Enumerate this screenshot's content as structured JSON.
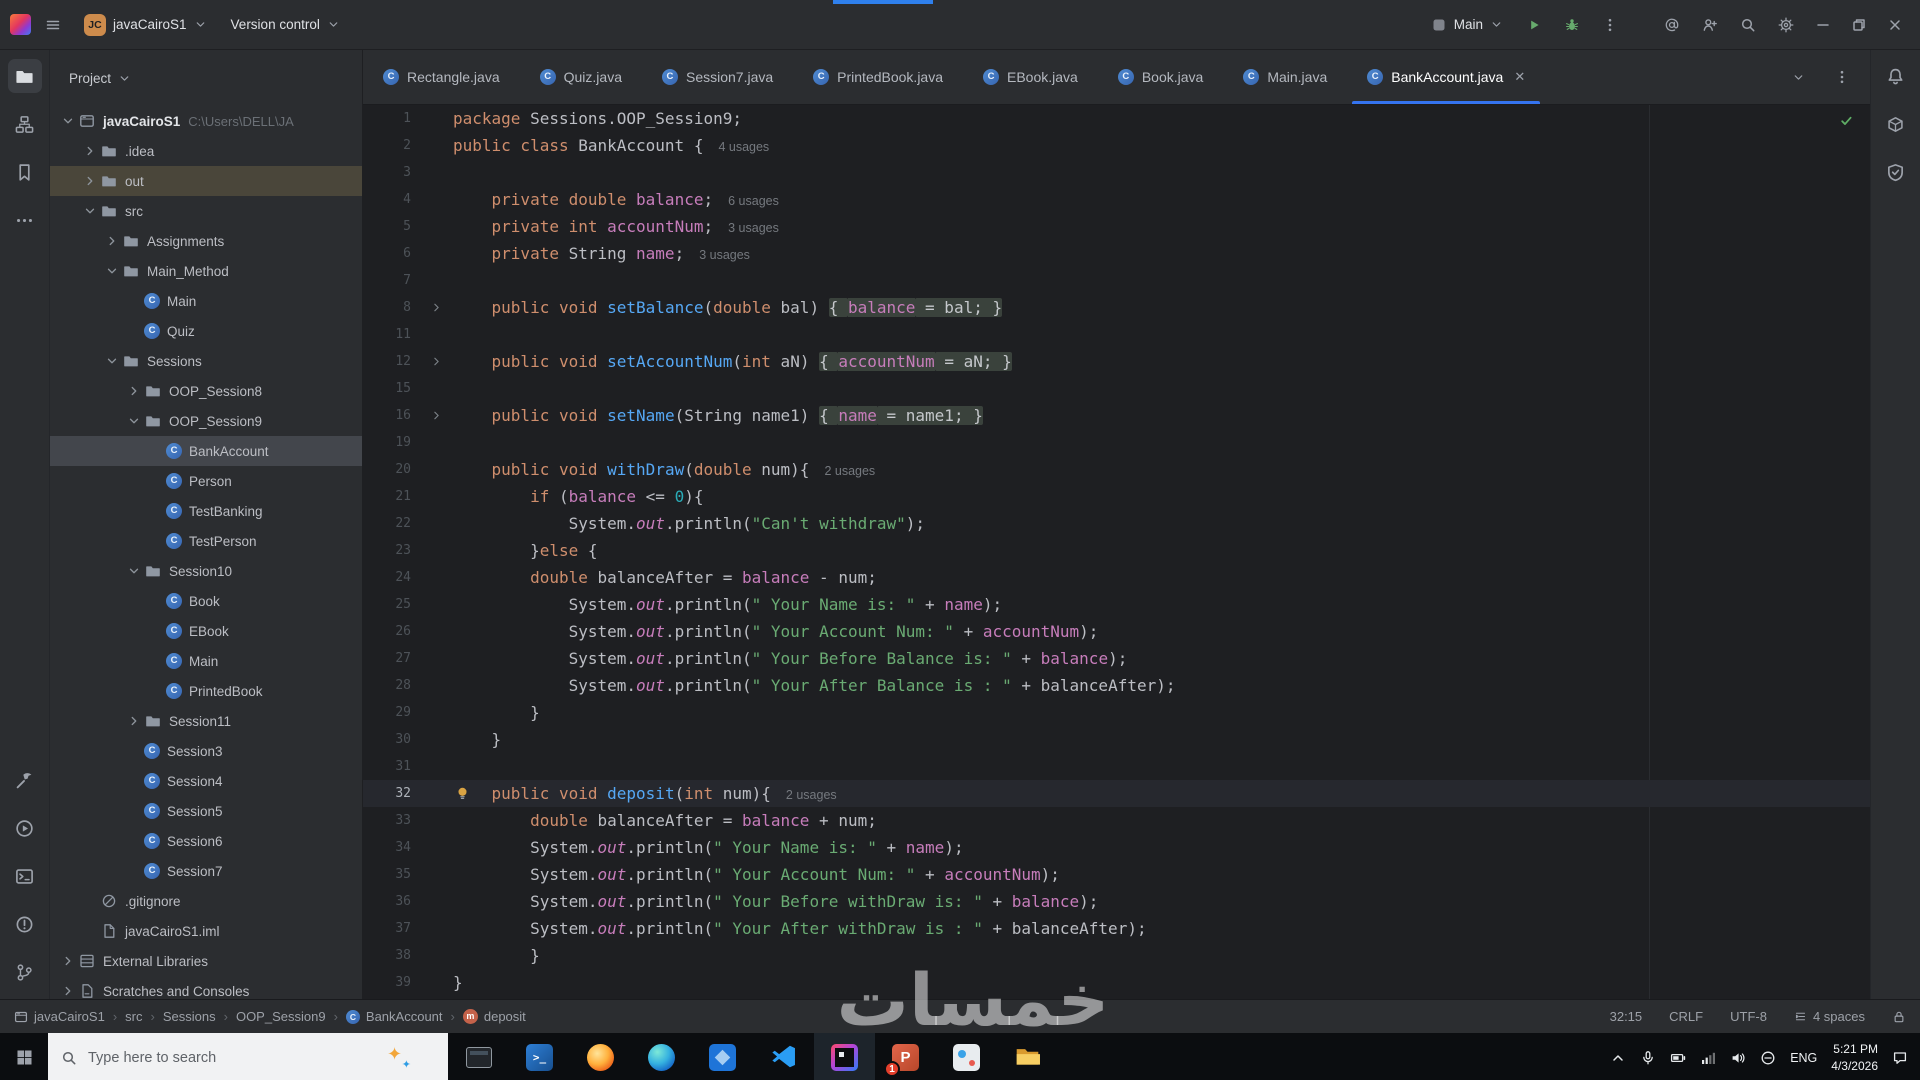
{
  "title_bar": {
    "avatar": "JC",
    "project": "javaCairoS1",
    "vcs": "Version control",
    "run_config": "Main"
  },
  "tab_bar": {
    "tabs": [
      {
        "label": "Rectangle.java"
      },
      {
        "label": "Quiz.java"
      },
      {
        "label": "Session7.java"
      },
      {
        "label": "PrintedBook.java"
      },
      {
        "label": "EBook.java"
      },
      {
        "label": "Book.java"
      },
      {
        "label": "Main.java"
      },
      {
        "label": "BankAccount.java",
        "active": true
      }
    ]
  },
  "left_strip": {
    "top": [
      "project",
      "structure",
      "bookmarks",
      "more-tools"
    ],
    "bottom": [
      "build",
      "services",
      "terminal",
      "problems",
      "version-control"
    ],
    "active": "project"
  },
  "right_strip": [
    "notifications",
    "build-tools",
    "dependency-checker"
  ],
  "project_panel": {
    "header": "Project",
    "tree": [
      {
        "depth": 0,
        "label": "javaCairoS1",
        "icon": "project",
        "chevron": "open",
        "bold": true,
        "suffix": "C:\\Users\\DELL\\JA"
      },
      {
        "depth": 1,
        "label": ".idea",
        "icon": "folder",
        "chevron": "closed"
      },
      {
        "depth": 1,
        "label": "out",
        "icon": "folder",
        "chevron": "closed",
        "highlight": true
      },
      {
        "depth": 1,
        "label": "src",
        "icon": "folder",
        "chevron": "open"
      },
      {
        "depth": 2,
        "label": "Assignments",
        "icon": "folder",
        "chevron": "closed"
      },
      {
        "depth": 2,
        "label": "Main_Method",
        "icon": "folder",
        "chevron": "open"
      },
      {
        "depth": 3,
        "label": "Main",
        "icon": "class"
      },
      {
        "depth": 3,
        "label": "Quiz",
        "icon": "class"
      },
      {
        "depth": 2,
        "label": "Sessions",
        "icon": "folder",
        "chevron": "open"
      },
      {
        "depth": 3,
        "label": "OOP_Session8",
        "icon": "folder",
        "chevron": "closed"
      },
      {
        "depth": 3,
        "label": "OOP_Session9",
        "icon": "folder",
        "chevron": "open"
      },
      {
        "depth": 4,
        "label": "BankAccount",
        "icon": "class",
        "selected": true
      },
      {
        "depth": 4,
        "label": "Person",
        "icon": "class"
      },
      {
        "depth": 4,
        "label": "TestBanking",
        "icon": "class"
      },
      {
        "depth": 4,
        "label": "TestPerson",
        "icon": "class"
      },
      {
        "depth": 3,
        "label": "Session10",
        "icon": "folder",
        "chevron": "open"
      },
      {
        "depth": 4,
        "label": "Book",
        "icon": "class"
      },
      {
        "depth": 4,
        "label": "EBook",
        "icon": "class"
      },
      {
        "depth": 4,
        "label": "Main",
        "icon": "class"
      },
      {
        "depth": 4,
        "label": "PrintedBook",
        "icon": "class"
      },
      {
        "depth": 3,
        "label": "Session11",
        "icon": "folder",
        "chevron": "closed"
      },
      {
        "depth": 3,
        "label": "Session3",
        "icon": "class"
      },
      {
        "depth": 3,
        "label": "Session4",
        "icon": "class"
      },
      {
        "depth": 3,
        "label": "Session5",
        "icon": "class"
      },
      {
        "depth": 3,
        "label": "Session6",
        "icon": "class"
      },
      {
        "depth": 3,
        "label": "Session7",
        "icon": "class"
      },
      {
        "depth": 1,
        "label": ".gitignore",
        "icon": "ignore"
      },
      {
        "depth": 1,
        "label": "javaCairoS1.iml",
        "icon": "file"
      },
      {
        "depth": 0,
        "label": "External Libraries",
        "icon": "library",
        "chevron": "closed"
      },
      {
        "depth": 0,
        "label": "Scratches and Consoles",
        "icon": "scratch",
        "chevron": "closed"
      }
    ]
  },
  "editor": {
    "lines": [
      {
        "num": "1",
        "tokens": [
          [
            "kw",
            "package"
          ],
          [
            "pl",
            " Sessions.OOP_Session9;"
          ]
        ]
      },
      {
        "num": "2",
        "tokens": [
          [
            "kw",
            "public class"
          ],
          [
            "pl",
            " BankAccount {"
          ]
        ],
        "hint": "4 usages"
      },
      {
        "num": "3",
        "tokens": []
      },
      {
        "num": "4",
        "tokens": [
          [
            "pl",
            "    "
          ],
          [
            "kw",
            "private double"
          ],
          [
            "pl",
            " "
          ],
          [
            "fld",
            "balance"
          ],
          [
            "pl",
            ";"
          ]
        ],
        "hint": "6 usages"
      },
      {
        "num": "5",
        "tokens": [
          [
            "pl",
            "    "
          ],
          [
            "kw",
            "private int"
          ],
          [
            "pl",
            " "
          ],
          [
            "fld",
            "accountNum"
          ],
          [
            "pl",
            ";"
          ]
        ],
        "hint": "3 usages"
      },
      {
        "num": "6",
        "tokens": [
          [
            "pl",
            "    "
          ],
          [
            "kw",
            "private"
          ],
          [
            "pl",
            " String "
          ],
          [
            "fld",
            "name"
          ],
          [
            "pl",
            ";"
          ]
        ],
        "hint": "3 usages"
      },
      {
        "num": "7",
        "tokens": []
      },
      {
        "num": "8",
        "fold": true,
        "tokens": [
          [
            "pl",
            "    "
          ],
          [
            "kw",
            "public void"
          ],
          [
            "pl",
            " "
          ],
          [
            "mtd",
            "setBalance"
          ],
          [
            "pl",
            "("
          ],
          [
            "kw",
            "double"
          ],
          [
            "pl",
            " bal) "
          ],
          [
            "fold",
            "{ "
          ],
          [
            "ffld",
            "balance"
          ],
          [
            "fold",
            " = bal; }"
          ]
        ]
      },
      {
        "num": "11",
        "tokens": []
      },
      {
        "num": "12",
        "fold": true,
        "tokens": [
          [
            "pl",
            "    "
          ],
          [
            "kw",
            "public void"
          ],
          [
            "pl",
            " "
          ],
          [
            "mtd",
            "setAccountNum"
          ],
          [
            "pl",
            "("
          ],
          [
            "kw",
            "int"
          ],
          [
            "pl",
            " aN) "
          ],
          [
            "fold",
            "{ "
          ],
          [
            "ffld",
            "accountNum"
          ],
          [
            "fold",
            " = aN; }"
          ]
        ]
      },
      {
        "num": "15",
        "tokens": []
      },
      {
        "num": "16",
        "fold": true,
        "tokens": [
          [
            "pl",
            "    "
          ],
          [
            "kw",
            "public void"
          ],
          [
            "pl",
            " "
          ],
          [
            "mtd",
            "setName"
          ],
          [
            "pl",
            "(String name1) "
          ],
          [
            "fold",
            "{ "
          ],
          [
            "ffld",
            "name"
          ],
          [
            "fold",
            " = name1; }"
          ]
        ]
      },
      {
        "num": "19",
        "tokens": []
      },
      {
        "num": "20",
        "tokens": [
          [
            "pl",
            "    "
          ],
          [
            "kw",
            "public void"
          ],
          [
            "pl",
            " "
          ],
          [
            "mtd",
            "withDraw"
          ],
          [
            "pl",
            "("
          ],
          [
            "kw",
            "double"
          ],
          [
            "pl",
            " num){"
          ]
        ],
        "hint": "2 usages"
      },
      {
        "num": "21",
        "tokens": [
          [
            "pl",
            "        "
          ],
          [
            "kw",
            "if"
          ],
          [
            "pl",
            " ("
          ],
          [
            "fld",
            "balance"
          ],
          [
            "pl",
            " <= "
          ],
          [
            "num",
            "0"
          ],
          [
            "pl",
            "){"
          ]
        ]
      },
      {
        "num": "22",
        "tokens": [
          [
            "pl",
            "            System."
          ],
          [
            "outf",
            "out"
          ],
          [
            "pl",
            ".println("
          ],
          [
            "str",
            "\"Can't withdraw\""
          ],
          [
            "pl",
            ");"
          ]
        ]
      },
      {
        "num": "23",
        "tokens": [
          [
            "pl",
            "        }"
          ],
          [
            "kw",
            "else"
          ],
          [
            "pl",
            " {"
          ]
        ]
      },
      {
        "num": "24",
        "tokens": [
          [
            "pl",
            "        "
          ],
          [
            "kw",
            "double"
          ],
          [
            "pl",
            " balanceAfter = "
          ],
          [
            "fld",
            "balance"
          ],
          [
            "pl",
            " - num;"
          ]
        ]
      },
      {
        "num": "25",
        "tokens": [
          [
            "pl",
            "            System."
          ],
          [
            "outf",
            "out"
          ],
          [
            "pl",
            ".println("
          ],
          [
            "str",
            "\" Your Name is: \""
          ],
          [
            "pl",
            " + "
          ],
          [
            "fld",
            "name"
          ],
          [
            "pl",
            ");"
          ]
        ]
      },
      {
        "num": "26",
        "tokens": [
          [
            "pl",
            "            System."
          ],
          [
            "outf",
            "out"
          ],
          [
            "pl",
            ".println("
          ],
          [
            "str",
            "\" Your Account Num: \""
          ],
          [
            "pl",
            " + "
          ],
          [
            "fld",
            "accountNum"
          ],
          [
            "pl",
            ");"
          ]
        ]
      },
      {
        "num": "27",
        "tokens": [
          [
            "pl",
            "            System."
          ],
          [
            "outf",
            "out"
          ],
          [
            "pl",
            ".println("
          ],
          [
            "str",
            "\" Your Before Balance is: \""
          ],
          [
            "pl",
            " + "
          ],
          [
            "fld",
            "balance"
          ],
          [
            "pl",
            ");"
          ]
        ]
      },
      {
        "num": "28",
        "tokens": [
          [
            "pl",
            "            System."
          ],
          [
            "outf",
            "out"
          ],
          [
            "pl",
            ".println("
          ],
          [
            "str",
            "\" Your After Balance is : \""
          ],
          [
            "pl",
            " + balanceAfter);"
          ]
        ]
      },
      {
        "num": "29",
        "tokens": [
          [
            "pl",
            "        }"
          ]
        ]
      },
      {
        "num": "30",
        "tokens": [
          [
            "pl",
            "    }"
          ]
        ]
      },
      {
        "num": "31",
        "tokens": []
      },
      {
        "num": "32",
        "current": true,
        "bulb": true,
        "tokens": [
          [
            "pl",
            "    "
          ],
          [
            "kw",
            "public void"
          ],
          [
            "pl",
            " "
          ],
          [
            "mtd",
            "deposit"
          ],
          [
            "pl",
            "("
          ],
          [
            "kw",
            "int"
          ],
          [
            "pl",
            " num){"
          ]
        ],
        "hint": "2 usages"
      },
      {
        "num": "33",
        "tokens": [
          [
            "pl",
            "        "
          ],
          [
            "kw",
            "double"
          ],
          [
            "pl",
            " balanceAfter = "
          ],
          [
            "fld",
            "balance"
          ],
          [
            "pl",
            " + num;"
          ]
        ]
      },
      {
        "num": "34",
        "tokens": [
          [
            "pl",
            "        System."
          ],
          [
            "outf",
            "out"
          ],
          [
            "pl",
            ".println("
          ],
          [
            "str",
            "\" Your Name is: \""
          ],
          [
            "pl",
            " + "
          ],
          [
            "fld",
            "name"
          ],
          [
            "pl",
            ");"
          ]
        ]
      },
      {
        "num": "35",
        "tokens": [
          [
            "pl",
            "        System."
          ],
          [
            "outf",
            "out"
          ],
          [
            "pl",
            ".println("
          ],
          [
            "str",
            "\" Your Account Num: \""
          ],
          [
            "pl",
            " + "
          ],
          [
            "fld",
            "accountNum"
          ],
          [
            "pl",
            ");"
          ]
        ]
      },
      {
        "num": "36",
        "tokens": [
          [
            "pl",
            "        System."
          ],
          [
            "outf",
            "out"
          ],
          [
            "pl",
            ".println("
          ],
          [
            "str",
            "\" Your Before withDraw is: \""
          ],
          [
            "pl",
            " + "
          ],
          [
            "fld",
            "balance"
          ],
          [
            "pl",
            ");"
          ]
        ]
      },
      {
        "num": "37",
        "tokens": [
          [
            "pl",
            "        System."
          ],
          [
            "outf",
            "out"
          ],
          [
            "pl",
            ".println("
          ],
          [
            "str",
            "\" Your After withDraw is : \""
          ],
          [
            "pl",
            " + balanceAfter);"
          ]
        ]
      },
      {
        "num": "38",
        "tokens": [
          [
            "pl",
            "        }"
          ]
        ]
      },
      {
        "num": "39",
        "tokens": [
          [
            "pl",
            "}"
          ]
        ]
      }
    ]
  },
  "status_bar": {
    "breadcrumbs": [
      {
        "label": "javaCairoS1",
        "icon": "project"
      },
      {
        "label": "src"
      },
      {
        "label": "Sessions"
      },
      {
        "label": "OOP_Session9"
      },
      {
        "label": "BankAccount",
        "icon": "class"
      },
      {
        "label": "deposit",
        "icon": "method"
      }
    ],
    "caret": "32:15",
    "line_sep": "CRLF",
    "encoding": "UTF-8",
    "indent": "4 spaces"
  },
  "taskbar": {
    "search_placeholder": "Type here to search",
    "apps": [
      {
        "name": "task-view"
      },
      {
        "name": "powershell"
      },
      {
        "name": "firefox"
      },
      {
        "name": "edge"
      },
      {
        "name": "photos"
      },
      {
        "name": "vscode"
      },
      {
        "name": "intellij",
        "active": true
      },
      {
        "name": "powerpoint",
        "badge": "1"
      },
      {
        "name": "paint"
      },
      {
        "name": "file-explorer"
      }
    ],
    "tray_icons": [
      "chevron-up",
      "microphone",
      "battery",
      "network",
      "volume",
      "antivirus"
    ],
    "language": "ENG",
    "time": "5:21 PM",
    "date": "4/3/2026"
  },
  "watermark": "خمسات"
}
